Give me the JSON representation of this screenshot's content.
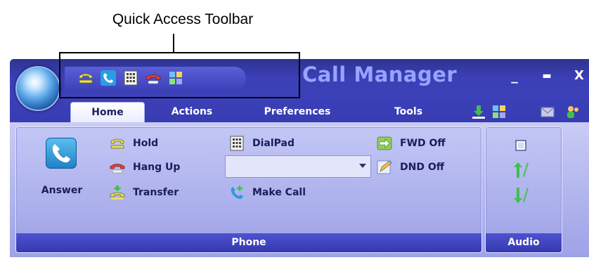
{
  "annotation": {
    "label": "Quick Access Toolbar"
  },
  "window": {
    "title": "Call Manager",
    "controls": {
      "minimize": "_",
      "maximize": "▬",
      "close": "X"
    }
  },
  "quick_access_toolbar": {
    "icons": [
      "hold-phone-icon",
      "answer-phone-icon",
      "dialpad-icon",
      "hangup-phone-icon",
      "tiles-icon"
    ]
  },
  "tabs": [
    {
      "label": "Home",
      "active": true
    },
    {
      "label": "Actions",
      "active": false
    },
    {
      "label": "Preferences",
      "active": false
    },
    {
      "label": "Tools",
      "active": false
    }
  ],
  "tab_icons": [
    "download-icon",
    "tiles-icon",
    "mail-icon",
    "contacts-icon"
  ],
  "ribbon": {
    "phone_group": {
      "label": "Phone",
      "answer": "Answer",
      "hold": "Hold",
      "hang_up": "Hang Up",
      "transfer": "Transfer",
      "dialpad": "DialPad",
      "number_input_value": "",
      "make_call": "Make Call",
      "fwd": "FWD Off",
      "dnd": "DND Off"
    },
    "audio_group": {
      "label": "Audio",
      "buttons": [
        "checkbox-icon",
        "volume-up-icon",
        "volume-down-icon"
      ]
    }
  },
  "colors": {
    "window_bg": "#3b3fb5",
    "title_text": "#98a3ff",
    "ribbon_bg": "#b4b8ef",
    "group_label_bg": "#3f44c0"
  }
}
